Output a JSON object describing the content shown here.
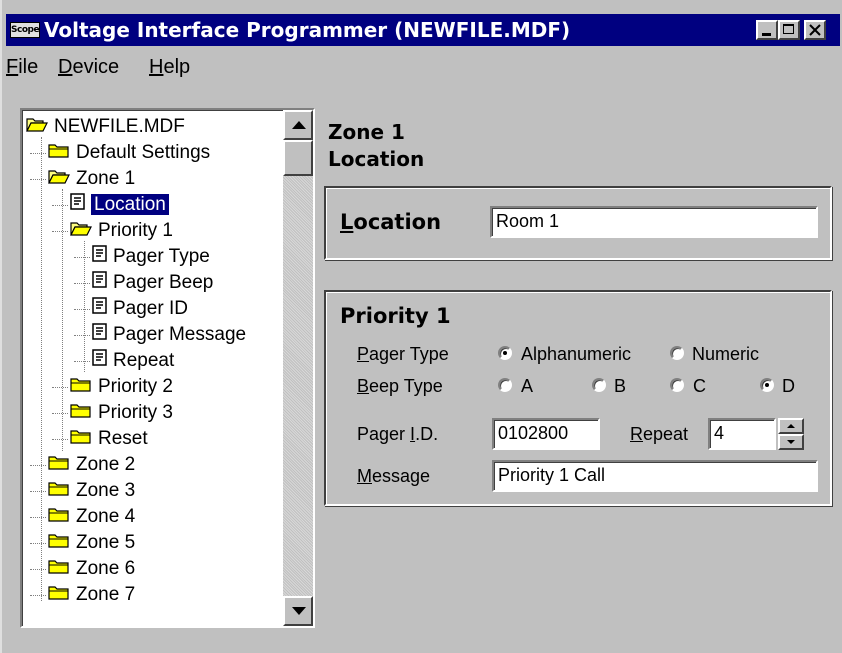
{
  "window": {
    "title": "Voltage Interface Programmer (NEWFILE.MDF)",
    "app_icon_text": "Scope",
    "accent_color": "#000080"
  },
  "menu": {
    "items": [
      {
        "label": "File",
        "mnemonic": "F"
      },
      {
        "label": "Device",
        "mnemonic": "D"
      },
      {
        "label": "Help",
        "mnemonic": "H"
      }
    ]
  },
  "tree": {
    "items": [
      {
        "label": "NEWFILE.MDF",
        "icon": "folder-open-icon"
      },
      {
        "label": "Default Settings",
        "icon": "folder-icon"
      },
      {
        "label": "Zone 1",
        "icon": "folder-open-icon"
      },
      {
        "label": "Location",
        "icon": "document-icon",
        "selected": true
      },
      {
        "label": "Priority 1",
        "icon": "folder-open-icon"
      },
      {
        "label": "Pager Type",
        "icon": "document-icon"
      },
      {
        "label": "Pager Beep",
        "icon": "document-icon"
      },
      {
        "label": "Pager ID",
        "icon": "document-icon"
      },
      {
        "label": "Pager Message",
        "icon": "document-icon"
      },
      {
        "label": "Repeat",
        "icon": "document-icon"
      },
      {
        "label": "Priority 2",
        "icon": "folder-icon"
      },
      {
        "label": "Priority 3",
        "icon": "folder-icon"
      },
      {
        "label": "Reset",
        "icon": "folder-icon"
      },
      {
        "label": "Zone 2",
        "icon": "folder-icon"
      },
      {
        "label": "Zone 3",
        "icon": "folder-icon"
      },
      {
        "label": "Zone 4",
        "icon": "folder-icon"
      },
      {
        "label": "Zone 5",
        "icon": "folder-icon"
      },
      {
        "label": "Zone 6",
        "icon": "folder-icon"
      },
      {
        "label": "Zone 7",
        "icon": "folder-icon"
      }
    ]
  },
  "panel": {
    "heading_line1": "Zone 1",
    "heading_line2": "Location",
    "location": {
      "label": "Location",
      "mnemonic": "L",
      "value": "Room 1"
    },
    "priority": {
      "title": "Priority 1",
      "pager_type_label": "Pager Type",
      "pager_type_mnemonic": "P",
      "pager_type_options": [
        "Alphanumeric",
        "Numeric"
      ],
      "pager_type_selected": "Alphanumeric",
      "beep_type_label": "Beep Type",
      "beep_type_mnemonic": "B",
      "beep_options": [
        "A",
        "B",
        "C",
        "D"
      ],
      "beep_selected": "D",
      "pager_id_label": "Pager I.D.",
      "pager_id_mnemonic": "I",
      "pager_id_value": "0102800",
      "repeat_label": "Repeat",
      "repeat_mnemonic": "R",
      "repeat_value": "4",
      "message_label": "Message",
      "message_mnemonic": "M",
      "message_value": "Priority 1 Call"
    }
  }
}
